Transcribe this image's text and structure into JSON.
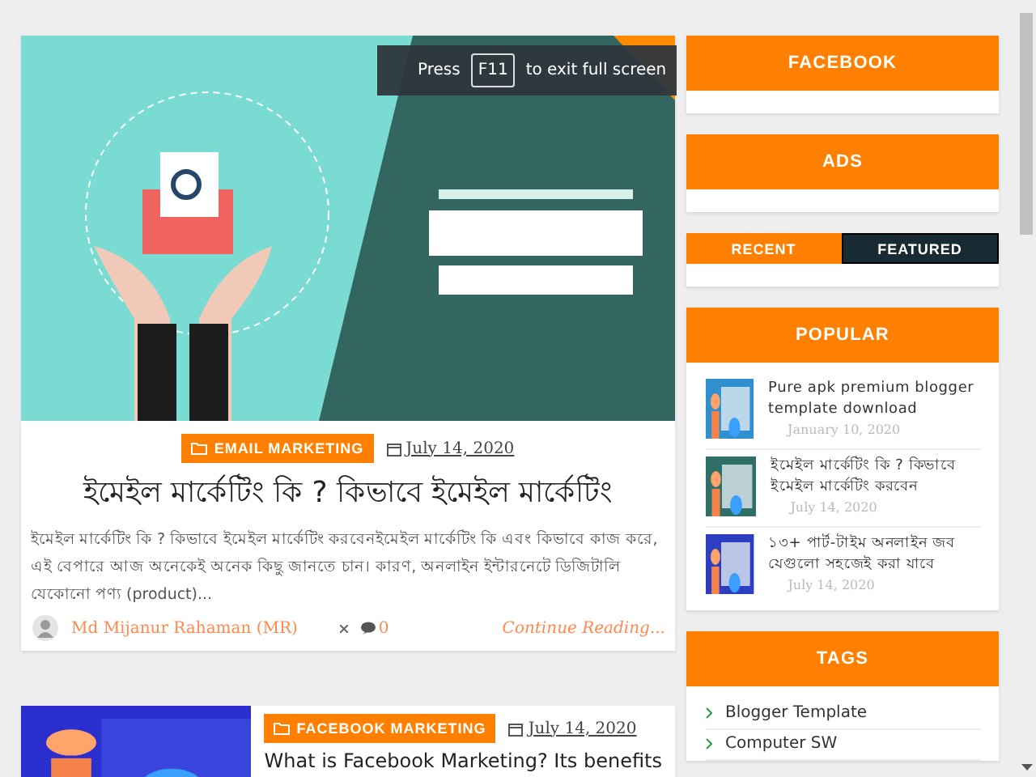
{
  "toast": {
    "before": "Press",
    "key": "F11",
    "after": "to exit full screen"
  },
  "posts": [
    {
      "kind": "full",
      "category": "EMAIL MARKETING",
      "date": "July 14, 2020",
      "title": "ইমেইল মার্কেটিং কি ? কিভাবে ইমেইল মার্কেটিং",
      "excerpt": "ইমেইল মার্কেটিং কি ? কিভাবে ইমেইল মার্কেটিং করবেনইমেইল মার্কেটিং কি এবং কিভাবে কাজ করে, এই বেপারে আজ অনেকেই অনেক কিছু জানতে চান। কারণ, অনলাইন ইন্টারনেটে ডিজিটালি যেকোনো পণ্য (product)...",
      "author": "Md Mijanur Rahaman (MR)",
      "comments": "0",
      "more": "Continue Reading..."
    },
    {
      "kind": "side",
      "category": "FACEBOOK MARKETING",
      "date": "July 14, 2020",
      "title": "What is Facebook Marketing? Its benefits"
    }
  ],
  "widgets": [
    {
      "kind": "plain",
      "title": "FACEBOOK"
    },
    {
      "kind": "plain",
      "title": "ADS"
    },
    {
      "kind": "tabs",
      "tabs": [
        {
          "label": "RECENT",
          "selected": false
        },
        {
          "label": "FEATURED",
          "selected": true
        }
      ]
    },
    {
      "kind": "popular",
      "title": "POPULAR",
      "items": [
        {
          "title": "Pure apk premium blogger template download",
          "date": "January 10, 2020"
        },
        {
          "title": "ইমেইল মার্কেটিং কি ? কিভাবে ইমেইল মার্কেটিং করবেন",
          "date": "July 14, 2020"
        },
        {
          "title": "১৩+ পার্ট-টাইম অনলাইন জব যেগুলো সহজেই করা যাবে",
          "date": "July 14, 2020"
        }
      ]
    },
    {
      "kind": "tags",
      "title": "TAGS",
      "items": [
        "Blogger Template",
        "Computer SW"
      ]
    }
  ]
}
